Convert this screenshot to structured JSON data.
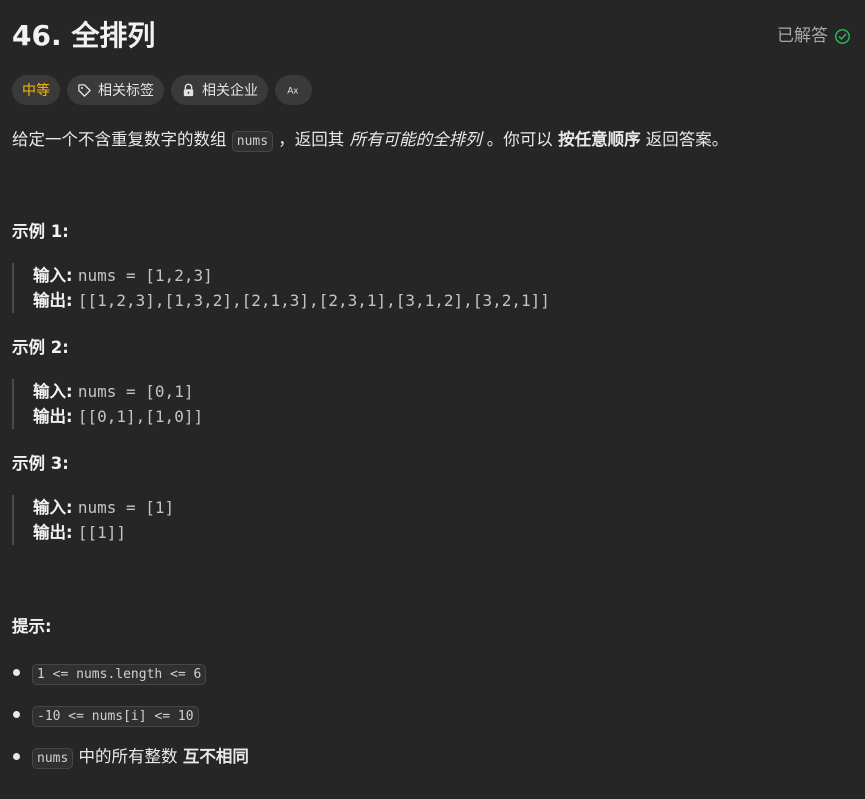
{
  "problem": {
    "title": "46. 全排列",
    "status": "已解答"
  },
  "tags": {
    "difficulty": "中等",
    "topics": "相关标签",
    "companies": "相关企业",
    "translate": "Ax"
  },
  "description": {
    "part1": "给定一个不含重复数字的数组 ",
    "code": "nums",
    "part2": " ，返回其 ",
    "italic": "所有可能的全排列",
    "part3": " 。你可以 ",
    "bold": "按任意顺序",
    "part4": " 返回答案。"
  },
  "examples": [
    {
      "title": "示例 1:",
      "input_label": "输入:",
      "input": "nums = [1,2,3]",
      "output_label": "输出:",
      "output": "[[1,2,3],[1,3,2],[2,1,3],[2,3,1],[3,1,2],[3,2,1]]"
    },
    {
      "title": "示例 2:",
      "input_label": "输入:",
      "input": "nums = [0,1]",
      "output_label": "输出:",
      "output": "[[0,1],[1,0]]"
    },
    {
      "title": "示例 3:",
      "input_label": "输入:",
      "input": "nums = [1]",
      "output_label": "输出:",
      "output": "[[1]]"
    }
  ],
  "constraints": {
    "title": "提示:",
    "c1": "1 <= nums.length <= 6",
    "c2": "-10 <= nums[i] <= 10",
    "c3_code": "nums",
    "c3_text": " 中的所有整数 ",
    "c3_bold": "互不相同"
  },
  "colors": {
    "background": "#262626",
    "difficulty_medium": "#ffb800",
    "solved_check": "#2cbb5d"
  }
}
